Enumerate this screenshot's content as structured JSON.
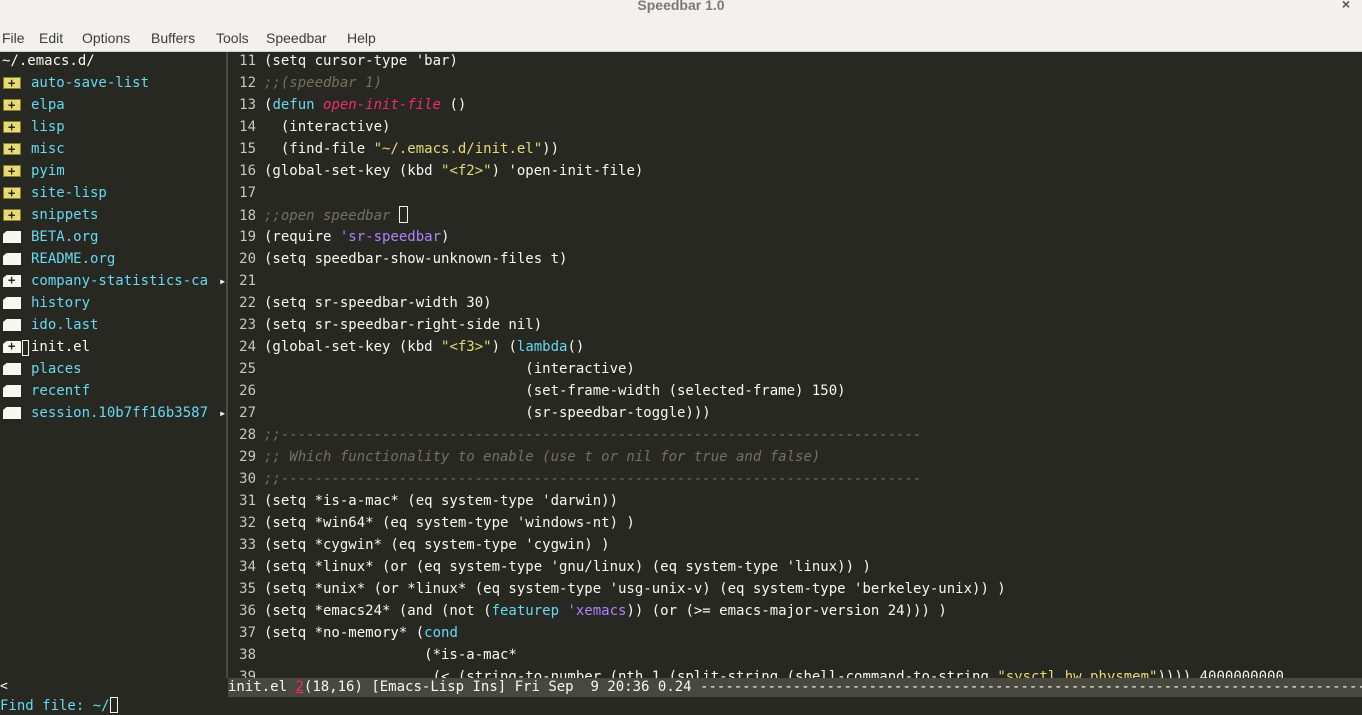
{
  "window": {
    "title": "Speedbar 1.0",
    "close_glyph": "×"
  },
  "menubar": [
    "File",
    "Edit",
    "Options",
    "Buffers",
    "Tools",
    "Speedbar",
    "Help"
  ],
  "speedbar": {
    "dir": "~/.emacs.d/",
    "entries": [
      {
        "type": "folder",
        "name": "auto-save-list"
      },
      {
        "type": "folder",
        "name": "elpa"
      },
      {
        "type": "folder",
        "name": "lisp"
      },
      {
        "type": "folder",
        "name": "misc"
      },
      {
        "type": "folder",
        "name": "pyim"
      },
      {
        "type": "folder",
        "name": "site-lisp"
      },
      {
        "type": "folder",
        "name": "snippets"
      },
      {
        "type": "file",
        "name": "BETA.org"
      },
      {
        "type": "file",
        "name": "README.org"
      },
      {
        "type": "file-plus",
        "name": "company-statistics-ca",
        "truncated": true
      },
      {
        "type": "file",
        "name": "history"
      },
      {
        "type": "file",
        "name": "ido.last"
      },
      {
        "type": "file-plus",
        "name": "init.el",
        "selected": true
      },
      {
        "type": "file",
        "name": "places"
      },
      {
        "type": "file",
        "name": "recentf"
      },
      {
        "type": "file",
        "name": "session.10b7ff16b3587",
        "truncated": true
      }
    ],
    "truncate_glyph": "▸"
  },
  "editor": {
    "lines": [
      {
        "n": "11",
        "segs": [
          [
            "(setq cursor-type ",
            "p"
          ],
          [
            "'bar",
            "q2"
          ],
          [
            ")",
            "p"
          ]
        ]
      },
      {
        "n": "12",
        "segs": [
          [
            ";;(speedbar 1)",
            "c"
          ]
        ]
      },
      {
        "n": "13",
        "segs": [
          [
            "(",
            "p"
          ],
          [
            "defun ",
            "k"
          ],
          [
            "open-init-file",
            "f"
          ],
          [
            " ()",
            "p"
          ]
        ]
      },
      {
        "n": "14",
        "segs": [
          [
            "  (interactive)",
            "p"
          ]
        ]
      },
      {
        "n": "15",
        "segs": [
          [
            "  (find-file ",
            "p"
          ],
          [
            "\"~/.emacs.d/init.el\"",
            "s"
          ],
          [
            "))",
            "p"
          ]
        ]
      },
      {
        "n": "16",
        "segs": [
          [
            "(global-set-key (kbd ",
            "p"
          ],
          [
            "\"<f2>\"",
            "s"
          ],
          [
            ") 'open-init-file)",
            "p"
          ]
        ]
      },
      {
        "n": "17",
        "segs": []
      },
      {
        "n": "18",
        "segs": [
          [
            ";;open speedbar ",
            "c"
          ]
        ],
        "cursor": true
      },
      {
        "n": "19",
        "segs": [
          [
            "(require ",
            "p"
          ],
          [
            "'sr-speedbar",
            "q"
          ],
          [
            ")",
            "p"
          ]
        ]
      },
      {
        "n": "20",
        "segs": [
          [
            "(setq speedbar-show-unknown-files t)",
            "p"
          ]
        ]
      },
      {
        "n": "21",
        "segs": []
      },
      {
        "n": "22",
        "segs": [
          [
            "(setq sr-speedbar-width 30)",
            "p"
          ]
        ]
      },
      {
        "n": "23",
        "segs": [
          [
            "(setq sr-speedbar-right-side nil)",
            "p"
          ]
        ]
      },
      {
        "n": "24",
        "segs": [
          [
            "(global-set-key (kbd ",
            "p"
          ],
          [
            "\"<f3>\"",
            "s"
          ],
          [
            ") (",
            "p"
          ],
          [
            "lambda",
            "k"
          ],
          [
            "()",
            "p"
          ]
        ]
      },
      {
        "n": "25",
        "segs": [
          [
            "                               (interactive)",
            "p"
          ]
        ]
      },
      {
        "n": "26",
        "segs": [
          [
            "                               (set-frame-width (selected-frame) 150)",
            "p"
          ]
        ]
      },
      {
        "n": "27",
        "segs": [
          [
            "                               (sr-speedbar-toggle)))",
            "p"
          ]
        ]
      },
      {
        "n": "28",
        "segs": [
          [
            ";;----------------------------------------------------------------------------",
            "c"
          ]
        ]
      },
      {
        "n": "29",
        "segs": [
          [
            ";; Which functionality to enable (use t or nil for true and false)",
            "c"
          ]
        ]
      },
      {
        "n": "30",
        "segs": [
          [
            ";;----------------------------------------------------------------------------",
            "c"
          ]
        ]
      },
      {
        "n": "31",
        "segs": [
          [
            "(setq *is-a-mac* (eq system-type 'darwin))",
            "p"
          ]
        ]
      },
      {
        "n": "32",
        "segs": [
          [
            "(setq *win64* (eq system-type 'windows-nt) )",
            "p"
          ]
        ]
      },
      {
        "n": "33",
        "segs": [
          [
            "(setq *cygwin* (eq system-type 'cygwin) )",
            "p"
          ]
        ]
      },
      {
        "n": "34",
        "segs": [
          [
            "(setq *linux* (or (eq system-type 'gnu/linux) (eq system-type 'linux)) )",
            "p"
          ]
        ]
      },
      {
        "n": "35",
        "segs": [
          [
            "(setq *unix* (or *linux* (eq system-type 'usg-unix-v) (eq system-type 'berkeley-unix)) )",
            "p"
          ]
        ]
      },
      {
        "n": "36",
        "segs": [
          [
            "(setq *emacs24* (and (not (",
            "p"
          ],
          [
            "featurep ",
            "k"
          ],
          [
            "'xemacs",
            "q"
          ],
          [
            ")) (or (>= emacs-major-version 24))) )",
            "p"
          ]
        ]
      },
      {
        "n": "37",
        "segs": [
          [
            "(setq *no-memory* (",
            "p"
          ],
          [
            "cond",
            "k"
          ]
        ]
      },
      {
        "n": "38",
        "segs": [
          [
            "                   (*is-a-mac*",
            "p"
          ]
        ]
      },
      {
        "n": "39",
        "segs": [
          [
            "                    (< (string-to-number (nth 1 (split-string (shell-command-to-string ",
            "p"
          ],
          [
            "\"sysctl hw.physmem\"",
            "s"
          ],
          [
            ")))) 4000000000",
            "p"
          ]
        ]
      }
    ]
  },
  "modeline": {
    "left": "<",
    "file": "init.el",
    "num": "2",
    "rest": "(18,16) [Emacs-Lisp Ins] Fri Sep  9 20:36 0.24 -----------------------------------------------------------------------------------"
  },
  "minibuffer": {
    "prompt": "Find file: ~/"
  }
}
